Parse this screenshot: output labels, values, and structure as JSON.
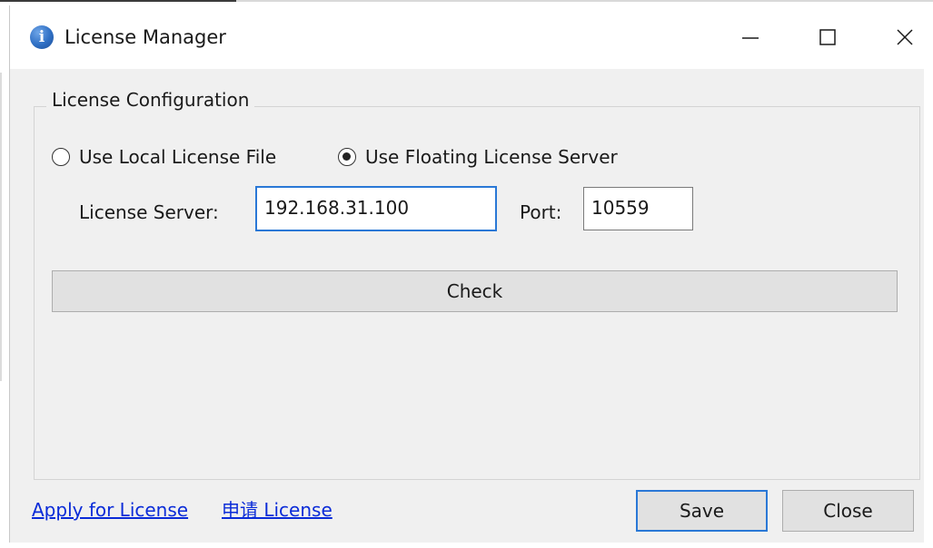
{
  "window": {
    "title": "License Manager",
    "icon": "info-icon"
  },
  "group": {
    "title": "License Configuration"
  },
  "mode": {
    "options": [
      {
        "label": "Use Local License File",
        "checked": false
      },
      {
        "label": "Use Floating License Server",
        "checked": true
      }
    ]
  },
  "server": {
    "label": "License Server:",
    "value": "192.168.31.100"
  },
  "port": {
    "label": "Port:",
    "value": "10559"
  },
  "actions": {
    "check_label": "Check",
    "save_label": "Save",
    "close_label": "Close"
  },
  "links": {
    "apply": "Apply for License",
    "apply_cn": "申请 License"
  },
  "colors": {
    "focus_border": "#2a78d6",
    "link": "#0a2bd8",
    "window_bg": "#f0f0f0"
  }
}
